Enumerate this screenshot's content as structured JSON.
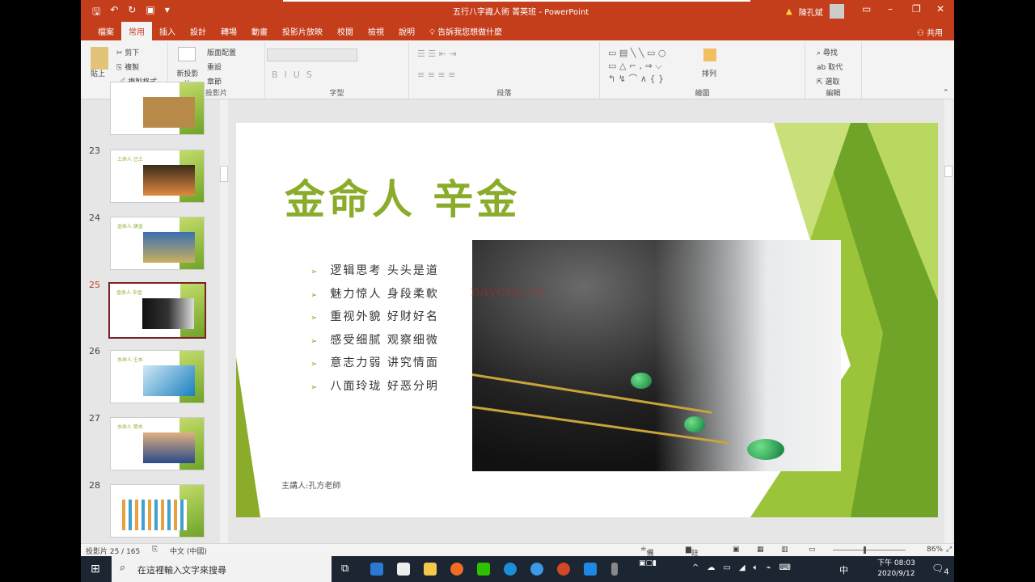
{
  "titlebar": {
    "document_title": "五行八字識人術 菁英班 - PowerPoint",
    "user": "陳孔斌",
    "quick_access": [
      "save-icon",
      "undo-icon",
      "redo-icon",
      "present-icon"
    ]
  },
  "tabs": [
    {
      "label": "檔案"
    },
    {
      "label": "常用",
      "active": true
    },
    {
      "label": "插入"
    },
    {
      "label": "設計"
    },
    {
      "label": "轉場"
    },
    {
      "label": "動畫"
    },
    {
      "label": "投影片放映"
    },
    {
      "label": "校閱"
    },
    {
      "label": "檢視"
    },
    {
      "label": "說明"
    },
    {
      "label": "告訴我您想做什麼"
    }
  ],
  "share": "共用",
  "ribbon": {
    "clipboard": {
      "label": "剪貼簿",
      "paste": "貼上",
      "cut": "剪下",
      "copy": "複製",
      "format_painter": "複製格式"
    },
    "slides": {
      "label": "投影片",
      "new_slide": "新投影片",
      "layout": "版面配置",
      "reset": "重設",
      "section": "章節"
    },
    "font": {
      "label": "字型"
    },
    "paragraph": {
      "label": "段落"
    },
    "drawing": {
      "label": "繪圖",
      "arrange": "排列"
    },
    "editing": {
      "label": "編輯",
      "find": "尋找",
      "replace": "取代",
      "select": "選取"
    }
  },
  "thumbnails": [
    {
      "num": "",
      "title": ""
    },
    {
      "num": "23",
      "title": "土命人 己土"
    },
    {
      "num": "24",
      "title": "金命人 庚金"
    },
    {
      "num": "25",
      "title": "金命人 辛金",
      "selected": true
    },
    {
      "num": "26",
      "title": "水命人 壬水"
    },
    {
      "num": "27",
      "title": "水命人 癸水"
    },
    {
      "num": "28",
      "title": ""
    }
  ],
  "slide": {
    "title": "金命人  辛金",
    "bullets": [
      "逻辑思考 头头是道",
      "魅力惊人 身段柔軟",
      "重视外貌 好财好名",
      "感受细腻 观察细微",
      "意志力弱 讲究情面",
      "八面玲珑 好恶分明"
    ],
    "speaker": "主講人:孔方老師",
    "watermark": "nayona.cn",
    "accent": "#8aac2a"
  },
  "status": {
    "slide_pos": "投影片 25 / 165",
    "language": "中文 (中國)",
    "notes": "備忘稿",
    "comments": "註解",
    "zoom": "86%"
  },
  "taskbar": {
    "search_placeholder": "在這裡輸入文字來搜尋",
    "time": "下午 08:03",
    "date": "2020/9/12",
    "ime": "中",
    "notifications": "4"
  },
  "colors": {
    "brand": "#c43e1c",
    "taskbar": "#1c2532"
  }
}
